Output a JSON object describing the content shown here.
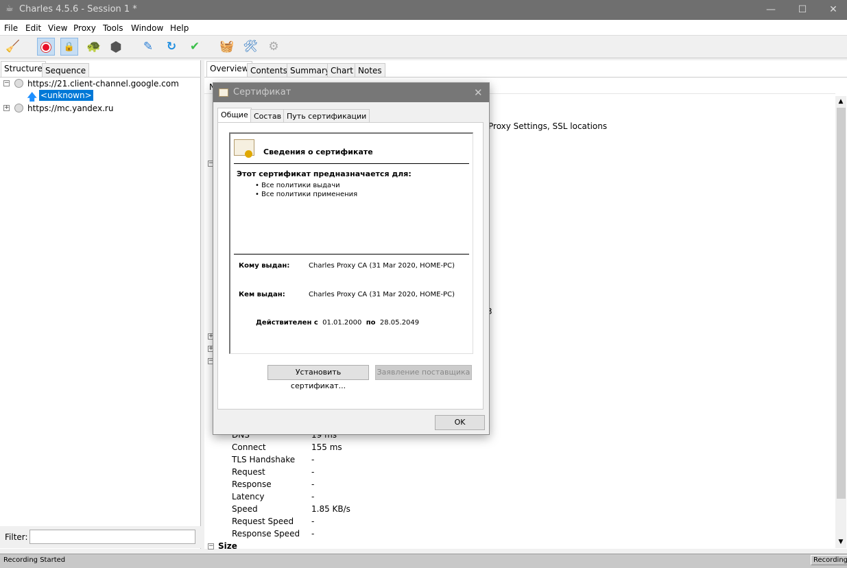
{
  "window": {
    "title": "Charles 4.5.6 - Session 1 *",
    "controls": [
      "minimize",
      "maximize",
      "close"
    ]
  },
  "menu": [
    "File",
    "Edit",
    "View",
    "Proxy",
    "Tools",
    "Window",
    "Help"
  ],
  "toolbar": [
    {
      "icon": "broom-icon",
      "active": false
    },
    {
      "icon": "record-icon",
      "active": true
    },
    {
      "icon": "ssl-lock-icon",
      "active": true
    },
    {
      "icon": "throttle-turtle-icon",
      "active": false
    },
    {
      "icon": "breakpoint-stop-icon",
      "active": false
    },
    {
      "icon": "compose-pen-icon",
      "active": false
    },
    {
      "icon": "repeat-icon",
      "active": false
    },
    {
      "icon": "validate-check-icon",
      "active": false
    },
    {
      "icon": "basket-icon",
      "active": false
    },
    {
      "icon": "tools-icon",
      "active": false
    },
    {
      "icon": "settings-gear-icon",
      "active": false
    }
  ],
  "left": {
    "tabs": [
      "Structure",
      "Sequence"
    ],
    "active_tab": "Structure",
    "tree": [
      {
        "label": "https://21.client-channel.google.com",
        "expanded": true,
        "children": [
          {
            "label": "<unknown>",
            "selected": true
          }
        ]
      },
      {
        "label": "https://mc.yandex.ru",
        "expanded": false
      }
    ],
    "filter_label": "Filter:",
    "filter_value": ""
  },
  "right": {
    "tabs": [
      "Overview",
      "Contents",
      "Summary",
      "Chart",
      "Notes"
    ],
    "active_tab": "Overview",
    "header_fragment": "N",
    "notes_fragment": "Proxy Settings, SSL locations",
    "fragment_3": "3",
    "timing_rows": [
      {
        "name": "DNS",
        "value": "19 ms"
      },
      {
        "name": "Connect",
        "value": "155 ms"
      },
      {
        "name": "TLS Handshake",
        "value": "-"
      },
      {
        "name": "Request",
        "value": "-"
      },
      {
        "name": "Response",
        "value": "-"
      },
      {
        "name": "Latency",
        "value": "-"
      },
      {
        "name": "Speed",
        "value": "1.85 KB/s"
      },
      {
        "name": "Request Speed",
        "value": "-"
      },
      {
        "name": "Response Speed",
        "value": "-"
      }
    ],
    "size_section": "Size"
  },
  "dialog": {
    "title": "Сертификат",
    "tabs": [
      "Общие",
      "Состав",
      "Путь сертификации"
    ],
    "active_tab": "Общие",
    "heading": "Сведения о сертификате",
    "purpose_label": "Этот сертификат предназначается для:",
    "purposes": [
      "Все политики выдачи",
      "Все политики применения"
    ],
    "issued_to_label": "Кому выдан:",
    "issued_to": "Charles Proxy CA (31 Mar 2020, HOME-PC)",
    "issued_by_label": "Кем выдан:",
    "issued_by": "Charles Proxy CA (31 Mar 2020, HOME-PC)",
    "valid_from_label": "Действителен с",
    "valid_from": "01.01.2000",
    "valid_to_label": "по",
    "valid_to": "28.05.2049",
    "install_button": "Установить сертификат...",
    "issuer_statement_button": "Заявление поставщика",
    "ok_button": "OK"
  },
  "status": {
    "message": "Recording Started",
    "indicator": "Recording"
  }
}
